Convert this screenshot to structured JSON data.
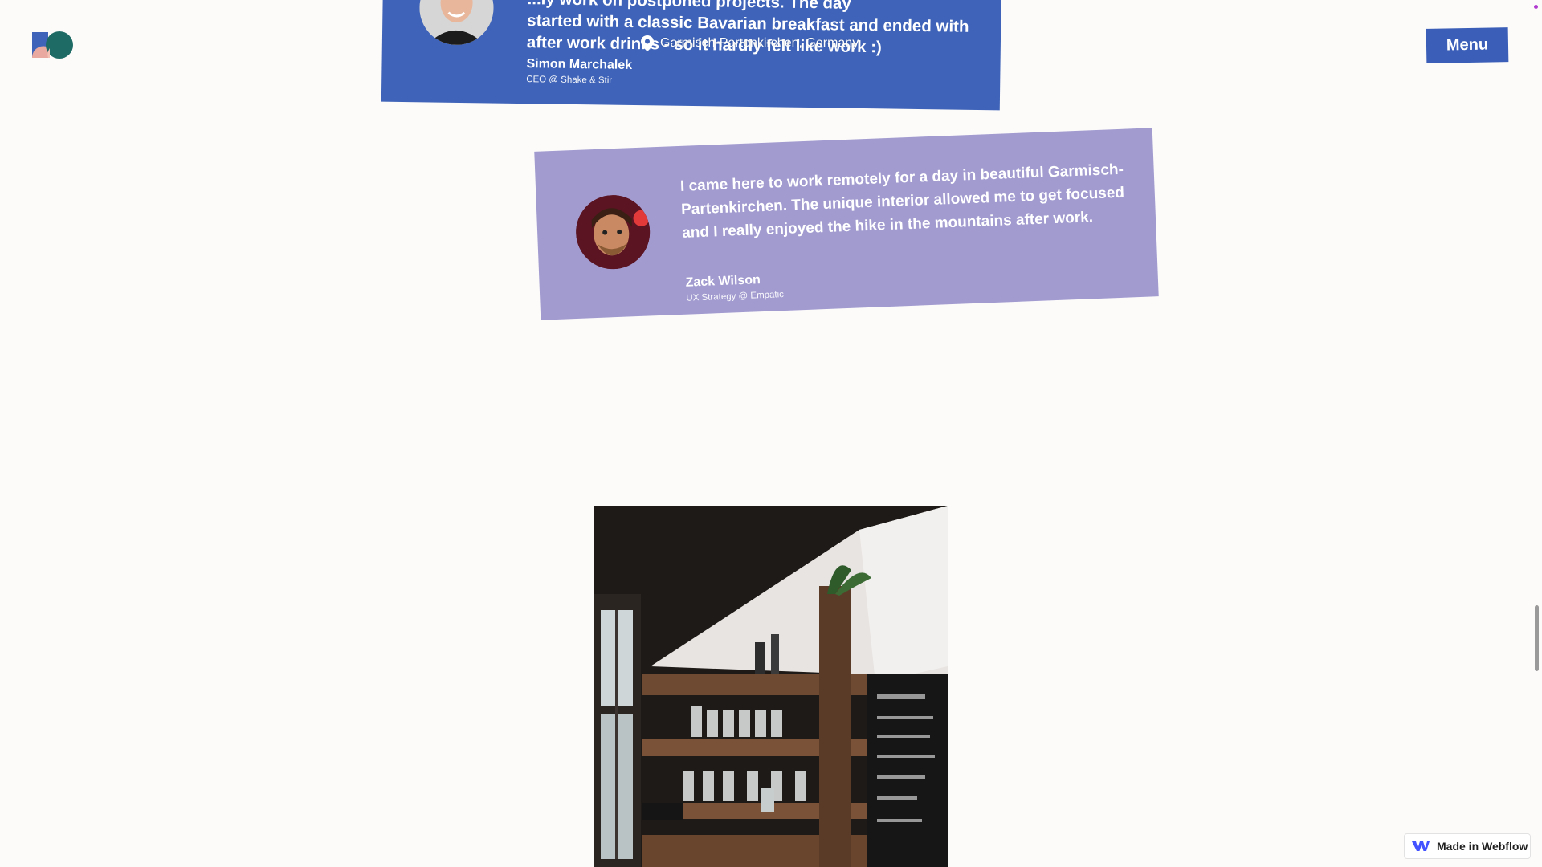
{
  "header": {
    "menu_label": "Menu"
  },
  "testimonials": [
    {
      "quote_lines": [
        "...ly work on postponed projects. The day",
        "started with a classic Bavarian breakfast and ended with",
        "after work drinks - so it hardly felt like work :)"
      ],
      "author": "Simon Marchalek",
      "role": "CEO @ Shake & Stir"
    },
    {
      "quote": "I came here to work remotely for a day in beautiful Garmisch-Partenkirchen. The unique interior allowed me to get focused and I really enjoyed the hike in the mountains after work.",
      "author": "Zack Wilson",
      "role": "UX Strategy @ Empatic"
    }
  ],
  "location": {
    "label": "Garmisch-Partenkirchen, Germany"
  },
  "badge": {
    "label": "Made in Webflow"
  },
  "colors": {
    "background": "#fdfbfa",
    "card_blue": "#3e63b8",
    "card_lavender": "#a19bd0",
    "menu_blue": "#3b5fb8",
    "logo_teal": "#1e6b65"
  },
  "icons": {
    "logo": "logo-icon",
    "location": "pin-icon",
    "badge": "webflow-icon"
  }
}
